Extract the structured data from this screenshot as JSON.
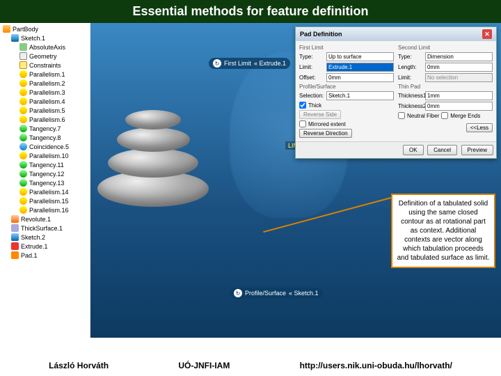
{
  "title": "Essential methods for feature definition",
  "tree": [
    {
      "label": "PartBody",
      "cls": "ic-part",
      "ind": 0
    },
    {
      "label": "Sketch.1",
      "cls": "ic-sk",
      "ind": 1
    },
    {
      "label": "AbsoluteAxis",
      "cls": "ic-ax",
      "ind": 2
    },
    {
      "label": "Geometry",
      "cls": "ic-gm",
      "ind": 2
    },
    {
      "label": "Constraints",
      "cls": "ic-cn",
      "ind": 2
    },
    {
      "label": "Parallelism.1",
      "cls": "ic-pl",
      "ind": 2
    },
    {
      "label": "Parallelism.2",
      "cls": "ic-pl",
      "ind": 2
    },
    {
      "label": "Parallelism.3",
      "cls": "ic-pl",
      "ind": 2
    },
    {
      "label": "Parallelism.4",
      "cls": "ic-pl",
      "ind": 2
    },
    {
      "label": "Parallelism.5",
      "cls": "ic-pl",
      "ind": 2
    },
    {
      "label": "Parallelism.6",
      "cls": "ic-pl",
      "ind": 2
    },
    {
      "label": "Tangency.7",
      "cls": "ic-tn",
      "ind": 2
    },
    {
      "label": "Tangency.8",
      "cls": "ic-tn",
      "ind": 2
    },
    {
      "label": "Coincidence.5",
      "cls": "ic-co",
      "ind": 2
    },
    {
      "label": "Parallelism.10",
      "cls": "ic-pl",
      "ind": 2
    },
    {
      "label": "Tangency.11",
      "cls": "ic-tn",
      "ind": 2
    },
    {
      "label": "Tangency.12",
      "cls": "ic-tn",
      "ind": 2
    },
    {
      "label": "Tangency.13",
      "cls": "ic-tn",
      "ind": 2
    },
    {
      "label": "Parallelism.14",
      "cls": "ic-pl",
      "ind": 2
    },
    {
      "label": "Parallelism.15",
      "cls": "ic-pl",
      "ind": 2
    },
    {
      "label": "Parallelism.16",
      "cls": "ic-pl",
      "ind": 2
    },
    {
      "label": "Revolute.1",
      "cls": "ic-rv",
      "ind": 1
    },
    {
      "label": "ThickSurface.1",
      "cls": "ic-th",
      "ind": 1
    },
    {
      "label": "Sketch.2",
      "cls": "ic-sk",
      "ind": 1
    },
    {
      "label": "Extrude.1",
      "cls": "ic-ex1",
      "ind": 1
    },
    {
      "label": "Pad.1",
      "cls": "ic-ex2",
      "ind": 1
    }
  ],
  "tags": {
    "t1a": "First Limit",
    "t1b": "« Extrude.1",
    "t2a": "Profile/Surface",
    "t2b": "« Sketch.1",
    "lim1": "LIM1"
  },
  "dialog": {
    "title": "Pad Definition",
    "first_limit": "First Limit",
    "second_limit": "Second Limit",
    "type_l": "Type:",
    "type_v1": "Up to surface",
    "type_v2": "Dimension",
    "limit_l": "Limit:",
    "limit_v": "Extrude.1",
    "length_l": "Length:",
    "length_v": "0mm",
    "offset_l": "Offset:",
    "offset_v": "0mm",
    "limit2_l": "Limit:",
    "limit2_v": "No selection",
    "profile": "Profile/Surface",
    "profile2": "Thin Pad",
    "sel_l": "Selection:",
    "sel_v": "Sketch.1",
    "th1_l": "Thickness1:",
    "th1_v": "1mm",
    "th2_l": "Thickness2:",
    "th2_v": "0mm",
    "thick": "Thick",
    "reverse": "Reverse Side",
    "mirror": "Mirrored extent",
    "neutral": "Neutral Fiber",
    "merge": "Merge Ends",
    "revdir": "Reverse Direction",
    "less": "<<Less",
    "ok": "OK",
    "cancel": "Cancel",
    "preview": "Preview"
  },
  "callout": "Definition of a tabulated solid using the same closed contour as at rotational part as context. Additional contexts are vector along which tabulation proceeds and tabulated surface as limit.",
  "footer": {
    "a": "László Horváth",
    "b": "UÓ-JNFI-IAM",
    "c": "http://users.nik.uni-obuda.hu/lhorvath/"
  }
}
